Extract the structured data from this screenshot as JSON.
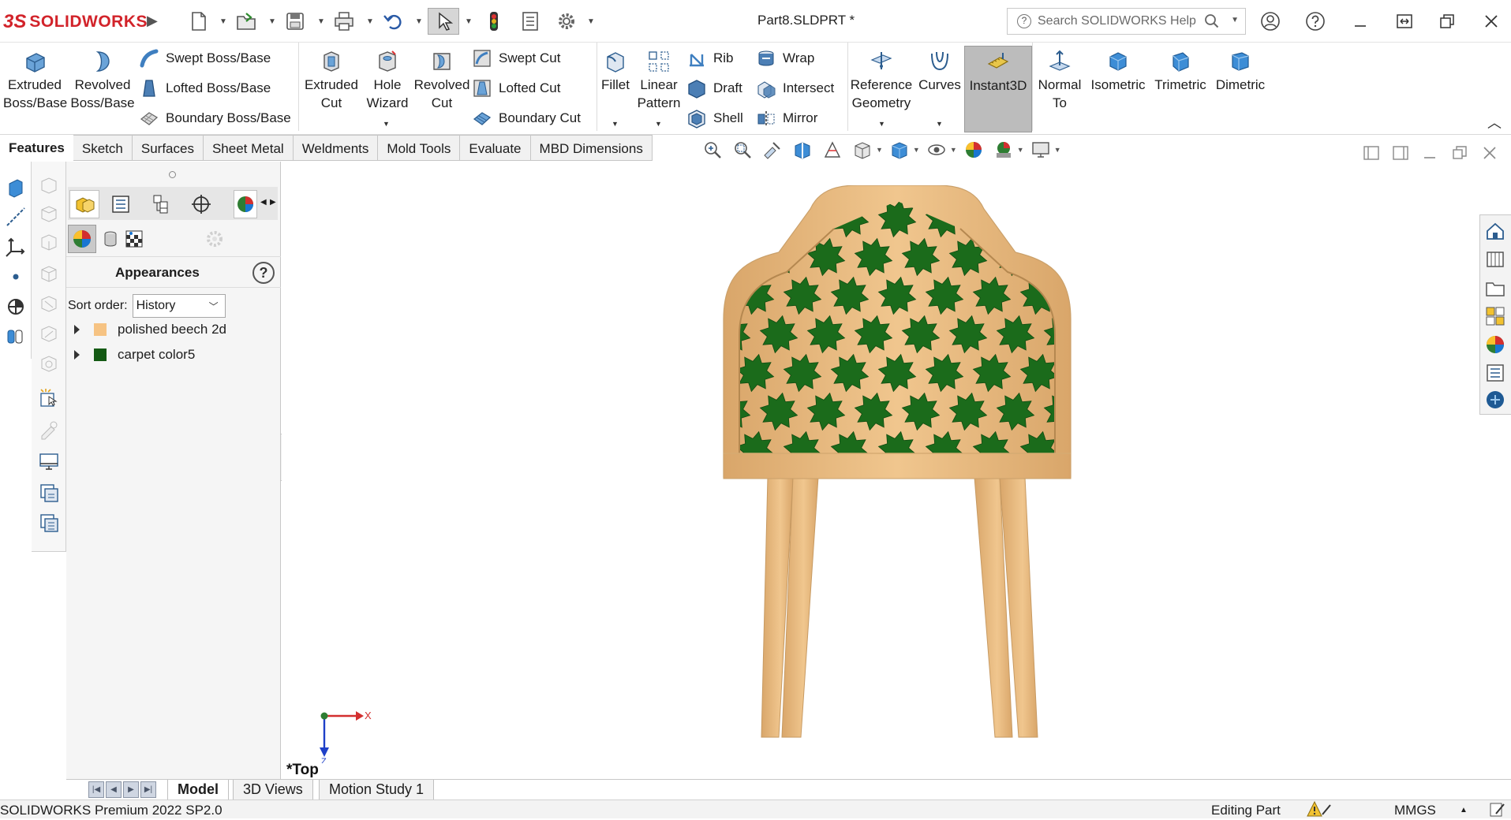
{
  "app": {
    "brand_ds": "3S",
    "brand_name": "SOLIDWORKS",
    "document_title": "Part8.SLDPRT *"
  },
  "search": {
    "placeholder": "Search SOLIDWORKS Help"
  },
  "commands": {
    "extruded_boss": "Extruded\nBoss/Base",
    "revolved_boss": "Revolved\nBoss/Base",
    "swept_boss": "Swept Boss/Base",
    "lofted_boss": "Lofted Boss/Base",
    "boundary_boss": "Boundary Boss/Base",
    "extruded_cut": "Extruded\nCut",
    "hole_wizard": "Hole\nWizard",
    "revolved_cut": "Revolved\nCut",
    "swept_cut": "Swept Cut",
    "lofted_cut": "Lofted Cut",
    "boundary_cut": "Boundary Cut",
    "fillet": "Fillet",
    "linear_pattern": "Linear\nPattern",
    "rib": "Rib",
    "draft": "Draft",
    "shell": "Shell",
    "wrap": "Wrap",
    "intersect": "Intersect",
    "mirror": "Mirror",
    "reference_geometry": "Reference\nGeometry",
    "curves": "Curves",
    "instant3d": "Instant3D",
    "normal_to": "Normal\nTo",
    "isometric": "Isometric",
    "trimetric": "Trimetric",
    "dimetric": "Dimetric"
  },
  "tabs": [
    "Features",
    "Sketch",
    "Surfaces",
    "Sheet Metal",
    "Weldments",
    "Mold Tools",
    "Evaluate",
    "MBD Dimensions"
  ],
  "appearances_panel": {
    "title": "Appearances",
    "help": "?",
    "sort_label": "Sort order:",
    "sort_value": "History",
    "items": [
      {
        "name": "polished beech 2d",
        "swatch": "#f6c383"
      },
      {
        "name": "carpet color5",
        "swatch": "#145a14"
      }
    ]
  },
  "viewport": {
    "view_name": "*Top",
    "axis_x": "X",
    "axis_z": "Z"
  },
  "model_colors": {
    "wood": "#f0c68e",
    "wood_dark": "#d9a66a",
    "carpet": "#1b6b1b"
  },
  "bottom_tabs": [
    "Model",
    "3D Views",
    "Motion Study 1"
  ],
  "status": {
    "product": "SOLIDWORKS Premium 2022 SP2.0",
    "mode": "Editing Part",
    "units": "MMGS"
  }
}
